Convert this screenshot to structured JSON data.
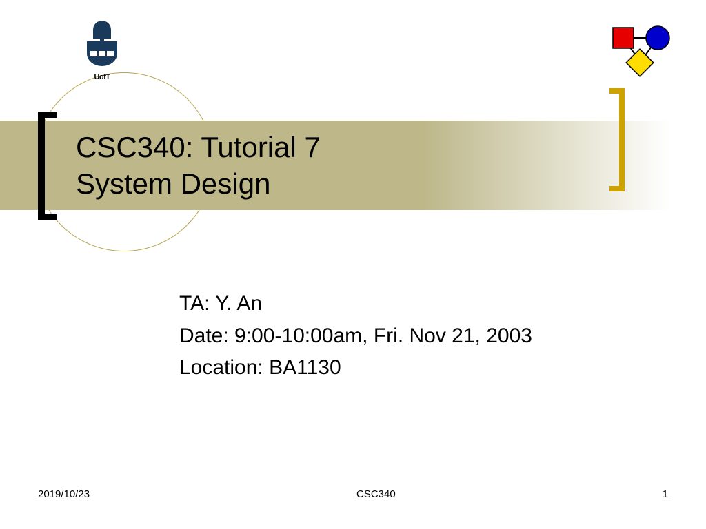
{
  "logo": {
    "label": "UofT"
  },
  "title": {
    "line1": "CSC340: Tutorial 7",
    "line2": "System Design"
  },
  "body": {
    "ta": "TA: Y. An",
    "date": "Date: 9:00-10:00am, Fri. Nov 21, 2003",
    "location": "Location: BA1130"
  },
  "footer": {
    "date": "2019/10/23",
    "center": "CSC340",
    "page": "1"
  }
}
